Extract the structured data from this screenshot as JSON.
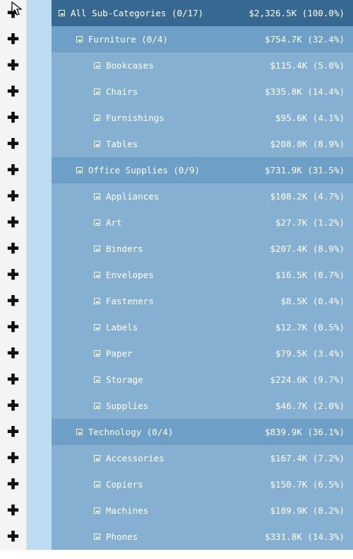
{
  "tree": [
    {
      "level": 0,
      "label": "All Sub-Categories (0/17)",
      "value": "$2,326.5K (100.0%)",
      "cursor": true
    },
    {
      "level": 1,
      "label": "Furniture (0/4)",
      "value": "$754.7K (32.4%)"
    },
    {
      "level": 2,
      "label": "Bookcases",
      "value": "$115.4K (5.0%)"
    },
    {
      "level": 2,
      "label": "Chairs",
      "value": "$335.8K (14.4%)"
    },
    {
      "level": 2,
      "label": "Furnishings",
      "value": "$95.6K (4.1%)"
    },
    {
      "level": 2,
      "label": "Tables",
      "value": "$208.0K (8.9%)"
    },
    {
      "level": 1,
      "label": "Office Supplies (0/9)",
      "value": "$731.9K (31.5%)"
    },
    {
      "level": 2,
      "label": "Appliances",
      "value": "$108.2K (4.7%)"
    },
    {
      "level": 2,
      "label": "Art",
      "value": "$27.7K (1.2%)"
    },
    {
      "level": 2,
      "label": "Binders",
      "value": "$207.4K (8.9%)"
    },
    {
      "level": 2,
      "label": "Envelopes",
      "value": "$16.5K (0.7%)"
    },
    {
      "level": 2,
      "label": "Fasteners",
      "value": "$8.5K (0.4%)"
    },
    {
      "level": 2,
      "label": "Labels",
      "value": "$12.7K (0.5%)"
    },
    {
      "level": 2,
      "label": "Paper",
      "value": "$79.5K (3.4%)"
    },
    {
      "level": 2,
      "label": "Storage",
      "value": "$224.6K (9.7%)"
    },
    {
      "level": 2,
      "label": "Supplies",
      "value": "$46.7K (2.0%)"
    },
    {
      "level": 1,
      "label": "Technology (0/4)",
      "value": "$839.9K (36.1%)"
    },
    {
      "level": 2,
      "label": "Accessories",
      "value": "$167.4K (7.2%)"
    },
    {
      "level": 2,
      "label": "Copiers",
      "value": "$150.7K (6.5%)"
    },
    {
      "level": 2,
      "label": "Machines",
      "value": "$189.9K (8.2%)"
    },
    {
      "level": 2,
      "label": "Phones",
      "value": "$331.8K (14.3%)"
    }
  ]
}
